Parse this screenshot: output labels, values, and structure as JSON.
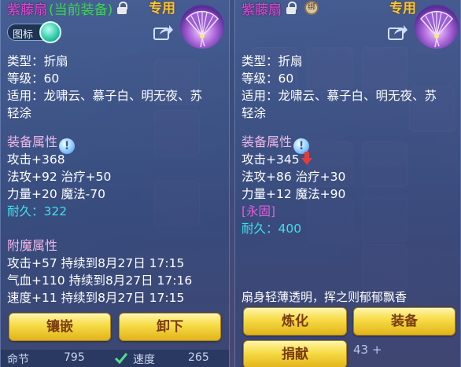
{
  "colors": {
    "name": "#e24bd6",
    "equipped": "#39d84a",
    "special": "#f2c640",
    "cyan": "#3ee0ea",
    "button": "#f6da44"
  },
  "left": {
    "name": "紫藤扇",
    "equip_tag": "(当前装备)",
    "special": "专用",
    "toggle_label": "图标",
    "basic": [
      "类型：折扇",
      "等级：60",
      "适用：龙啸云、慕子白、明无夜、苏",
      "轻涂"
    ],
    "attr_title": "装备属性",
    "attrs": [
      "攻击+368",
      "法攻+92 治疗+50",
      "力量+20 魔法-70"
    ],
    "durability": "耐久：322",
    "enchant_title": "附魔属性",
    "enchants": [
      "攻击+57 持续到8月27日 17:15",
      "气血+110 持续到8月27日 17:16",
      "速度+11 持续到8月27日 17:15"
    ],
    "buttons": {
      "inlay": "镶嵌",
      "unequip": "卸下"
    },
    "bottom": {
      "a": "命节",
      "b": "795",
      "c": "速度",
      "d": "265"
    }
  },
  "right": {
    "name": "紫藤扇",
    "seal": "绑",
    "special": "专用",
    "basic": [
      "类型：折扇",
      "等级：60",
      "适用：龙啸云、慕子白、明无夜、苏",
      "轻涂"
    ],
    "attr_title": "装备属性",
    "attrs": [
      "攻击+345",
      "法攻+86 治疗+30",
      "力量+12 魔法+90"
    ],
    "permanent": "[永固]",
    "durability": "耐久：400",
    "description": "扇身轻薄透明，挥之则郁郁飘香",
    "buttons": {
      "refine": "炼化",
      "equip": "装备",
      "donate": "捐献"
    },
    "bg_text": "43 +"
  },
  "icons": [
    "lock-icon",
    "seal-icon",
    "fan-icon",
    "share-icon",
    "info-icon",
    "down-arrow-icon",
    "check-icon"
  ]
}
